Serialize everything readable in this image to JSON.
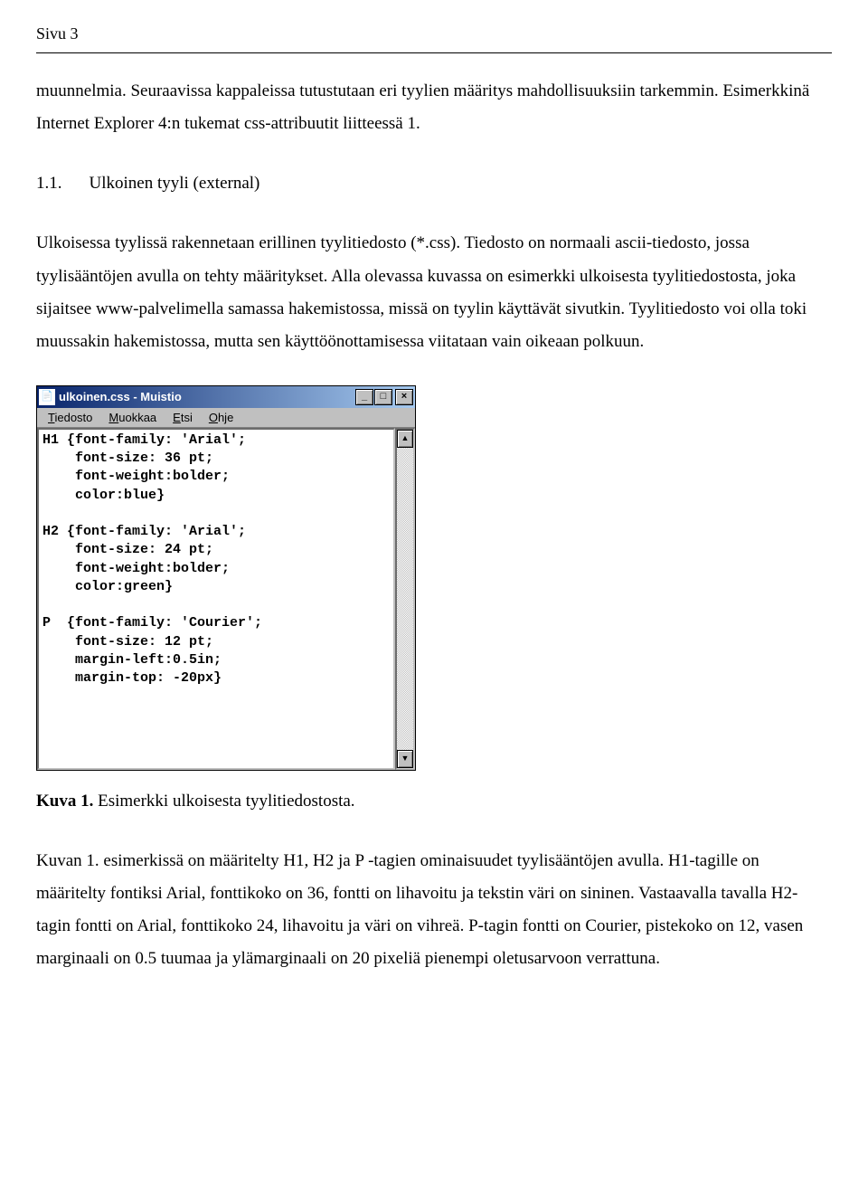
{
  "page_header": "Sivu 3",
  "paragraphs": {
    "intro": "muunnelmia. Seuraavissa kappaleissa tutustutaan eri tyylien määritys mahdollisuuksiin tarkemmin. Esimerkkinä Internet Explorer 4:n tukemat css-attribuutit liitteessä 1.",
    "section_num": "1.1.",
    "section_title": "Ulkoinen tyyli (external)",
    "body": "Ulkoisessa tyylissä rakennetaan erillinen tyylitiedosto (*.css). Tiedosto on normaali ascii-tiedosto, jossa tyylisääntöjen avulla on tehty määritykset. Alla olevassa kuvassa on esimerkki ulkoisesta tyylitiedostosta, joka sijaitsee www-palvelimella samassa hakemistossa, missä on tyylin käyttävät sivutkin. Tyylitiedosto voi olla toki muussakin hakemistossa, mutta sen käyttöönottamisessa viitataan vain oikeaan polkuun.",
    "caption_label": "Kuva 1.",
    "caption_text": " Esimerkki ulkoisesta tyylitiedostosta.",
    "conclusion": "Kuvan 1. esimerkissä on määritelty H1, H2 ja P -tagien ominaisuudet tyylisääntöjen avulla. H1-tagille on määritelty fontiksi Arial, fonttikoko on 36, fontti on lihavoitu ja tekstin väri on sininen. Vastaavalla tavalla H2-tagin fontti on Arial, fonttikoko 24, lihavoitu ja väri on vihreä. P-tagin fontti on Courier, pistekoko on 12, vasen marginaali on 0.5 tuumaa ja ylämarginaali on 20 pixeliä pienempi oletusarvoon verrattuna."
  },
  "notepad": {
    "title": "ulkoinen.css - Muistio",
    "menu": {
      "file": "Tiedosto",
      "edit": "Muokkaa",
      "search": "Etsi",
      "help": "Ohje"
    },
    "content": "H1 {font-family: 'Arial';\n    font-size: 36 pt;\n    font-weight:bolder;\n    color:blue}\n\nH2 {font-family: 'Arial';\n    font-size: 24 pt;\n    font-weight:bolder;\n    color:green}\n\nP  {font-family: 'Courier';\n    font-size: 12 pt;\n    margin-left:0.5in;\n    margin-top: -20px}"
  }
}
